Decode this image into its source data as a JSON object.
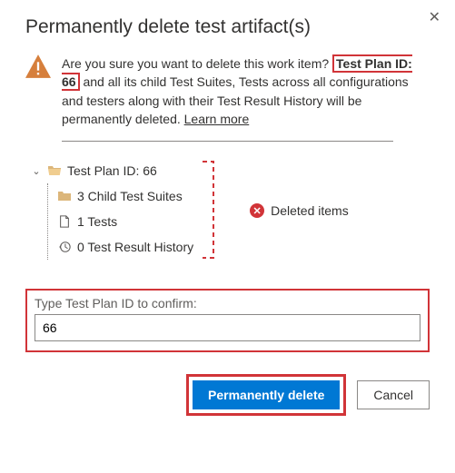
{
  "dialog": {
    "title": "Permanently delete test artifact(s)",
    "warning": {
      "pre": "Are you sure you want to delete this work item?",
      "highlight": "Test Plan ID: 66",
      "post": " and all its child Test Suites, Tests across all configurations and testers along with their Test Result History will be permanently deleted. ",
      "learn_more": "Learn more"
    },
    "tree": {
      "root": "Test Plan ID: 66",
      "children": {
        "suites": "3 Child Test Suites",
        "tests": "1 Tests",
        "history": "0 Test Result History"
      }
    },
    "deleted_label": "Deleted items",
    "confirm": {
      "label": "Type Test Plan ID to confirm:",
      "value": "66"
    },
    "buttons": {
      "primary": "Permanently delete",
      "secondary": "Cancel"
    }
  }
}
